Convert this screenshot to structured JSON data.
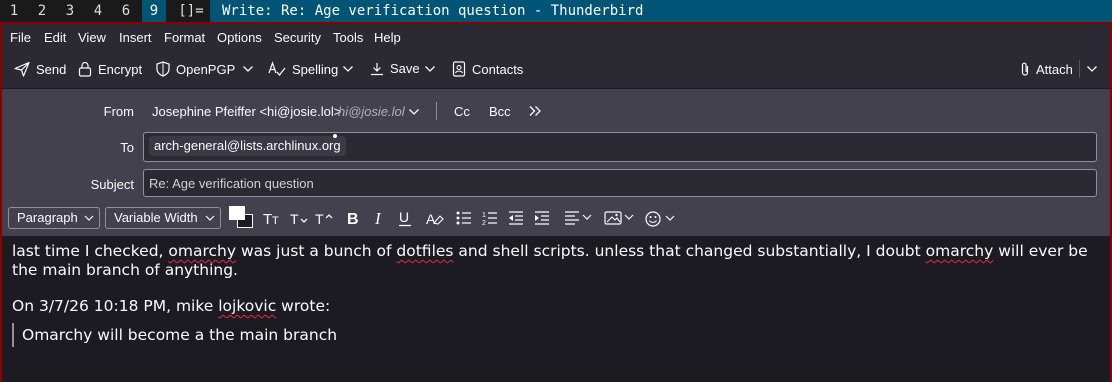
{
  "workspaces": [
    "1",
    "2",
    "3",
    "4",
    "6",
    "9"
  ],
  "active_workspace": "9",
  "layout_symbol": "[]=",
  "window_title": "Write: Re: Age verification question - Thunderbird",
  "menu": [
    "File",
    "Edit",
    "View",
    "Insert",
    "Format",
    "Options",
    "Security",
    "Tools",
    "Help"
  ],
  "toolbar": {
    "send": "Send",
    "encrypt": "Encrypt",
    "openpgp": "OpenPGP",
    "spelling": "Spelling",
    "save": "Save",
    "contacts": "Contacts",
    "attach": "Attach"
  },
  "header": {
    "from_label": "From",
    "from_value": "Josephine Pfeiffer <hi@josie.lol>",
    "from_alias": "hi@josie.lol",
    "cc": "Cc",
    "bcc": "Bcc",
    "to_label": "To",
    "to_recipient": "arch-general@lists.archlinux.org",
    "subject_label": "Subject",
    "subject_value": "Re: Age verification question"
  },
  "format": {
    "paragraph": "Paragraph",
    "font": "Variable Width"
  },
  "message": {
    "p1_a": "last time I checked, ",
    "p1_b": "omarchy",
    "p1_c": " was just a bunch of ",
    "p1_d": "dotfiles",
    "p1_e": " and shell scripts. unless that changed substantially, I doubt ",
    "p1_f": "omarchy",
    "p1_g": " will ever be the main branch of anything.",
    "attr_a": "On 3/7/26 10:18 PM, mike ",
    "attr_b": "lojkovic",
    "attr_c": " wrote:",
    "quote": "Omarchy will become a the main branch"
  }
}
